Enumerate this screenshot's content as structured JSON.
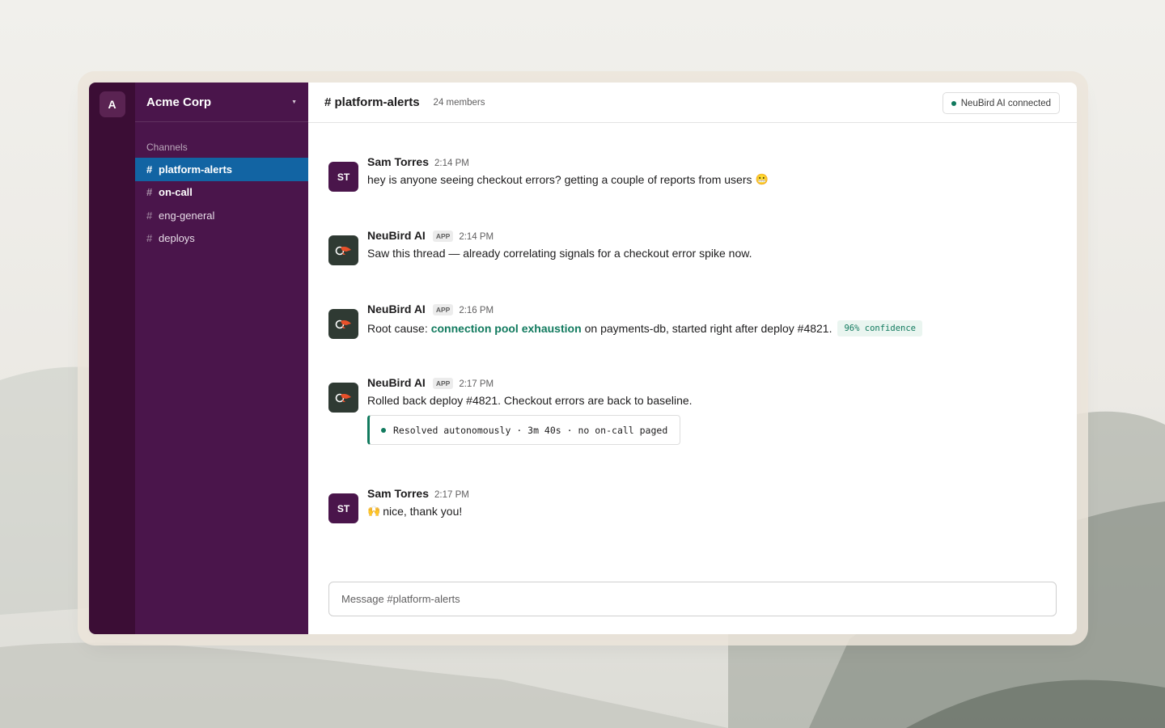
{
  "workspace": {
    "initial": "A",
    "name": "Acme Corp"
  },
  "sidebar": {
    "section_label": "Channels",
    "channels": [
      {
        "name": "platform-alerts",
        "state": "active"
      },
      {
        "name": "on-call",
        "state": "unread"
      },
      {
        "name": "eng-general",
        "state": "normal"
      },
      {
        "name": "deploys",
        "state": "normal"
      }
    ]
  },
  "header": {
    "channel_title": "# platform-alerts",
    "members": "24 members",
    "connection_badge": "NeuBird AI connected"
  },
  "messages": [
    {
      "author": "Sam Torres",
      "initials": "ST",
      "time": "2:14 PM",
      "text": "hey is anyone seeing checkout errors? getting a couple of reports from users",
      "emoji": "😬"
    },
    {
      "author": "NeuBird AI",
      "app_tag": "APP",
      "time": "2:14 PM",
      "text": "Saw this thread — already correlating signals for a checkout error spike now."
    },
    {
      "author": "NeuBird AI",
      "app_tag": "APP",
      "time": "2:16 PM",
      "text_before": "Root cause:",
      "link_text": "connection pool exhaustion",
      "text_after": "on payments-db, started right after deploy #4821.",
      "confidence": "96% confidence"
    },
    {
      "author": "NeuBird AI",
      "app_tag": "APP",
      "time": "2:17 PM",
      "text": "Rolled back deploy #4821. Checkout errors are back to baseline.",
      "status_card": "Resolved autonomously · 3m 40s · no on-call paged"
    },
    {
      "author": "Sam Torres",
      "initials": "ST",
      "time": "2:17 PM",
      "emoji": "🙌",
      "text": "nice, thank you!"
    }
  ],
  "composer": {
    "placeholder": "Message #platform-alerts"
  },
  "colors": {
    "sidebar": "#4a154b",
    "rail": "#3b0d35",
    "active_channel": "#1264a3",
    "accent_green": "#117a5e",
    "bot_avatar": "#2f3a33",
    "bird_orange": "#e8502a"
  }
}
